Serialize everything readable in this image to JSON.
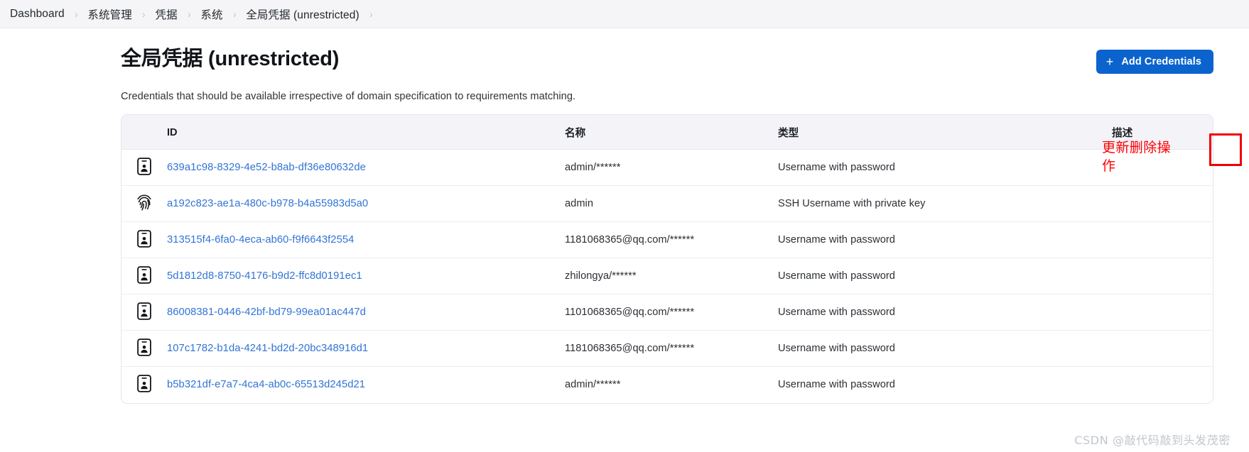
{
  "breadcrumb": {
    "separator": "›",
    "items": [
      {
        "label": "Dashboard"
      },
      {
        "label": "系统管理"
      },
      {
        "label": "凭据"
      },
      {
        "label": "系统"
      },
      {
        "label": "全局凭据 (unrestricted)"
      }
    ]
  },
  "header": {
    "title": "全局凭据 (unrestricted)",
    "add_button": {
      "label": "Add Credentials",
      "icon": "plus-icon"
    },
    "accent_color": "#0b63ce"
  },
  "main": {
    "subtitle": "Credentials that should be available irrespective of domain specification to requirements matching.",
    "table": {
      "columns": [
        "ID",
        "名称",
        "类型",
        "描述"
      ],
      "rows": [
        {
          "icon": "id-badge-icon",
          "id": "639a1c98-8329-4e52-b8ab-df36e80632de",
          "name": "admin/******",
          "type": "Username with password",
          "description": "",
          "action_icon": "wrench-icon"
        },
        {
          "icon": "fingerprint-icon",
          "id": "a192c823-ae1a-480c-b978-b4a55983d5a0",
          "name": "admin",
          "type": "SSH Username with private key",
          "description": "",
          "action_icon": "wrench-icon"
        },
        {
          "icon": "id-badge-icon",
          "id": "313515f4-6fa0-4eca-ab60-f9f6643f2554",
          "name": "1181068365@qq.com/******",
          "type": "Username with password",
          "description": "",
          "action_icon": "wrench-icon"
        },
        {
          "icon": "id-badge-icon",
          "id": "5d1812d8-8750-4176-b9d2-ffc8d0191ec1",
          "name": "zhilongya/******",
          "type": "Username with password",
          "description": "",
          "action_icon": "wrench-icon"
        },
        {
          "icon": "id-badge-icon",
          "id": "86008381-0446-42bf-bd79-99ea01ac447d",
          "name": "1101068365@qq.com/******",
          "type": "Username with password",
          "description": "",
          "action_icon": "wrench-icon"
        },
        {
          "icon": "id-badge-icon",
          "id": "107c1782-b1da-4241-bd2d-20bc348916d1",
          "name": "1181068365@qq.com/******",
          "type": "Username with password",
          "description": "",
          "action_icon": "wrench-icon"
        },
        {
          "icon": "id-badge-icon",
          "id": "b5b321df-e7a7-4ca4-ab0c-65513d245d21",
          "name": "admin/******",
          "type": "Username with password",
          "description": "",
          "action_icon": "wrench-icon"
        }
      ]
    }
  },
  "annotations": {
    "note_text": "更新删除操作",
    "note_color": "#ff0000",
    "highlight_color": "#f00000"
  },
  "watermark": {
    "text": "CSDN @敲代码敲到头发茂密"
  }
}
